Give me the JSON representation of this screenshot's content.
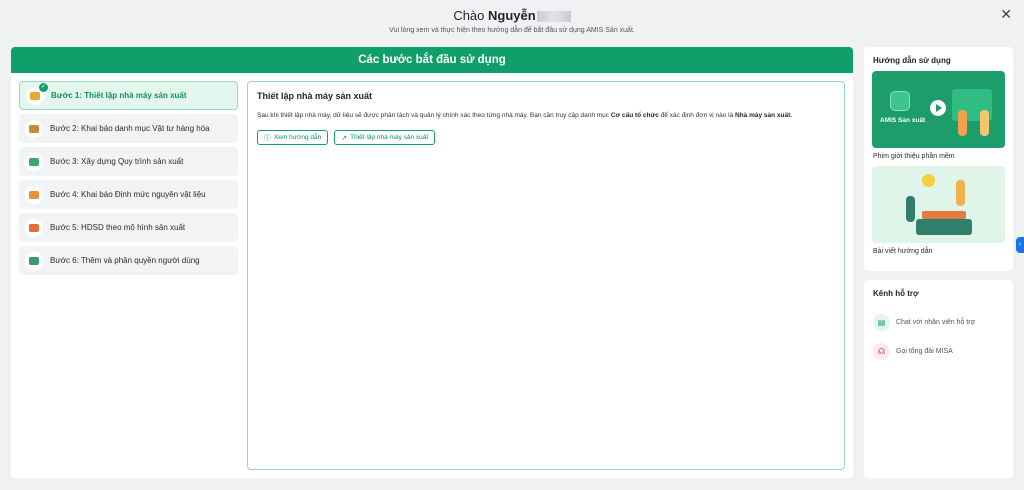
{
  "header": {
    "greeting": "Chào",
    "user_name": "Nguyễn",
    "subtitle": "Vui lòng xem và thực hiện theo hướng dẫn để bắt đầu sử dụng AMIS Sản xuất.",
    "close_symbol": "✕"
  },
  "banner": {
    "title": "Các bước bắt đầu sử dụng"
  },
  "steps": [
    {
      "label": "Bước 1: Thiết lập nhà máy sản xuất",
      "icon": "factory-icon",
      "active": true,
      "color": "#e8a33b"
    },
    {
      "label": "Bước 2: Khai báo danh mục Vật tư hàng hóa",
      "icon": "catalog-icon",
      "active": false,
      "color": "#c8893a"
    },
    {
      "label": "Bước 3: Xây dựng Quy trình sản xuất",
      "icon": "process-icon",
      "active": false,
      "color": "#3aa870"
    },
    {
      "label": "Bước 4: Khai báo Định mức nguyên vật liệu",
      "icon": "package-icon",
      "active": false,
      "color": "#e8913b"
    },
    {
      "label": "Bước 5: HDSD theo mô hình sản xuất",
      "icon": "guide-icon",
      "active": false,
      "color": "#e86b3b"
    },
    {
      "label": "Bước 6: Thêm và phân quyền người dùng",
      "icon": "users-icon",
      "active": false,
      "color": "#3a9a6e"
    }
  ],
  "content": {
    "title": "Thiết lập nhà máy sản xuất",
    "desc_1": "Sau khi thiết lập nhà máy, dữ liệu sẽ được phân tách và quản lý chính xác theo từng nhà máy. Bạn cần truy cập danh mục ",
    "desc_bold_1": "Cơ cấu tổ chức",
    "desc_2": " để xác định đơn vị nào là ",
    "desc_bold_2": "Nhà máy sản xuất.",
    "btn_guide": "Xem hướng dẫn",
    "btn_setup": "Thiết lập nhà máy sản xuất"
  },
  "guide_panel": {
    "title": "Hướng dẫn sử dụng",
    "video_brand": "AMIS Sản xuất",
    "video_caption": "Phim giới thiệu phần mềm",
    "article_caption": "Bài viết hướng dẫn"
  },
  "support_panel": {
    "title": "Kênh hỗ trợ",
    "chat": "Chat với nhân viên hỗ trợ",
    "call": "Gọi tổng đài MISA"
  },
  "colors": {
    "brand": "#109f6a",
    "accent_blue": "#1a73e8"
  }
}
